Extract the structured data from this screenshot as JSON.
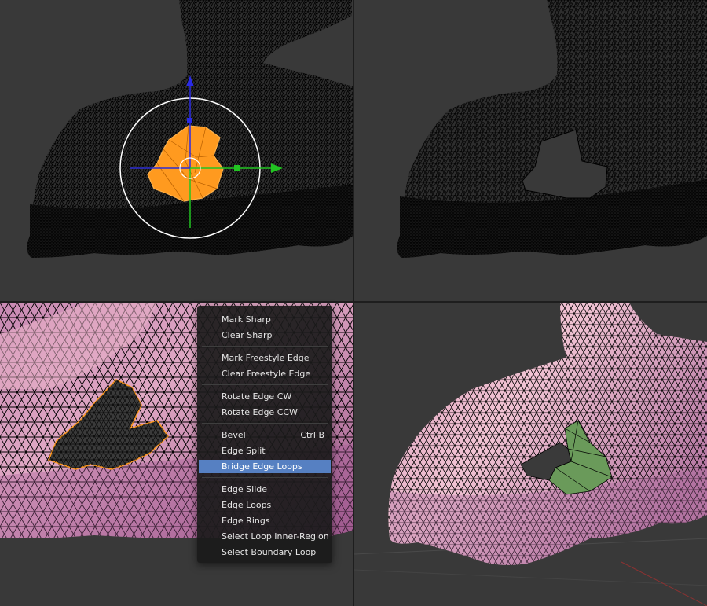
{
  "viewports": [
    {
      "id": "top-left",
      "shading": "wireframe",
      "mode": "edit"
    },
    {
      "id": "top-right",
      "shading": "wireframe",
      "mode": "edit"
    },
    {
      "id": "bottom-left",
      "shading": "solid",
      "mode": "edit"
    },
    {
      "id": "bottom-right",
      "shading": "solid",
      "mode": "edit"
    }
  ],
  "colors": {
    "viewport_bg": "#393939",
    "separator": "#1e1e1e",
    "wire": "#000000",
    "selection": "#ff9a1f",
    "mesh_pink": "#b46a9e",
    "mesh_pink_light": "#e9b3c8",
    "hole_dark": "#3a3a3a",
    "new_faces": "#6a9a5a",
    "axis_x": "#2d2dd2",
    "axis_y": "#22c422",
    "axis_z": "#2a2ae6",
    "menu_bg": "#1a1a1a",
    "menu_highlight": "#5680c2"
  },
  "menu": {
    "items": [
      {
        "label": "Mark Sharp",
        "shortcut": ""
      },
      {
        "label": "Clear Sharp",
        "shortcut": ""
      },
      {
        "label": "Mark Freestyle Edge",
        "shortcut": ""
      },
      {
        "label": "Clear Freestyle Edge",
        "shortcut": ""
      },
      {
        "label": "Rotate Edge CW",
        "shortcut": ""
      },
      {
        "label": "Rotate Edge CCW",
        "shortcut": ""
      },
      {
        "label": "Bevel",
        "shortcut": "Ctrl B"
      },
      {
        "label": "Edge Split",
        "shortcut": ""
      },
      {
        "label": "Bridge Edge Loops",
        "shortcut": "",
        "highlighted": true
      },
      {
        "label": "Edge Slide",
        "shortcut": ""
      },
      {
        "label": "Edge Loops",
        "shortcut": ""
      },
      {
        "label": "Edge Rings",
        "shortcut": ""
      },
      {
        "label": "Select Loop Inner-Region",
        "shortcut": ""
      },
      {
        "label": "Select Boundary Loop",
        "shortcut": ""
      }
    ]
  }
}
